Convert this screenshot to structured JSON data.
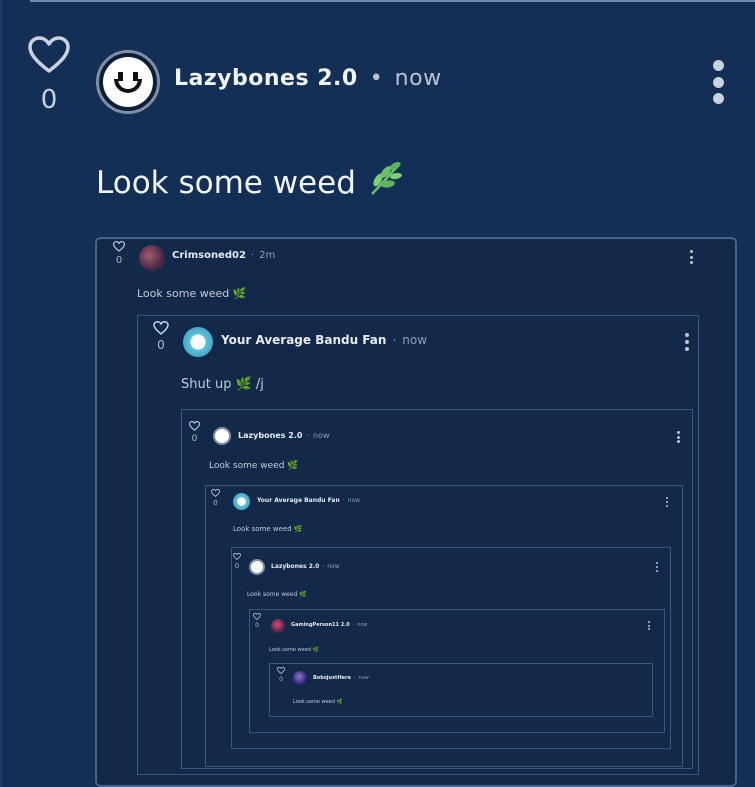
{
  "post": {
    "like_count": "0",
    "username": "Lazybones 2.0",
    "separator": "•",
    "time": "now",
    "text": "Look some weed",
    "emoji": "🌿"
  },
  "embed": {
    "level1": {
      "like_count": "0",
      "username": "Crimsoned02",
      "separator": "·",
      "time": "2m",
      "text": "Look some weed"
    },
    "level2": {
      "like_count": "0",
      "username": "Your Average Bandu Fan",
      "separator": "·",
      "time": "now",
      "text": "Shut up",
      "suffix": "/j"
    },
    "level3": {
      "like_count": "0",
      "username": "Lazybones 2.0",
      "separator": "·",
      "time": "now",
      "text": "Look some weed"
    },
    "level4": {
      "like_count": "0",
      "username": "Your Average Bandu Fan",
      "separator": "·",
      "time": "now",
      "text": "Look some weed"
    },
    "level5": {
      "like_count": "0",
      "username": "Lazybones 2.0",
      "separator": "·",
      "time": "now",
      "text": "Look some weed"
    },
    "level6": {
      "like_count": "0",
      "username": "GamingPerson11 2.0",
      "separator": "·",
      "time": "now",
      "text": "Look some weed"
    },
    "level7": {
      "like_count": "0",
      "username": "BobsjustHere",
      "separator": "·",
      "time": "now",
      "text": "Look some weed"
    }
  },
  "icons": {
    "heart": "heart-icon",
    "more": "more-vertical-icon",
    "leaf": "herb-leaf-emoji"
  },
  "colors": {
    "background": "#142f55",
    "text": "#f1f4f8",
    "muted": "#b9c4d3",
    "embed_border": "#46628a"
  }
}
